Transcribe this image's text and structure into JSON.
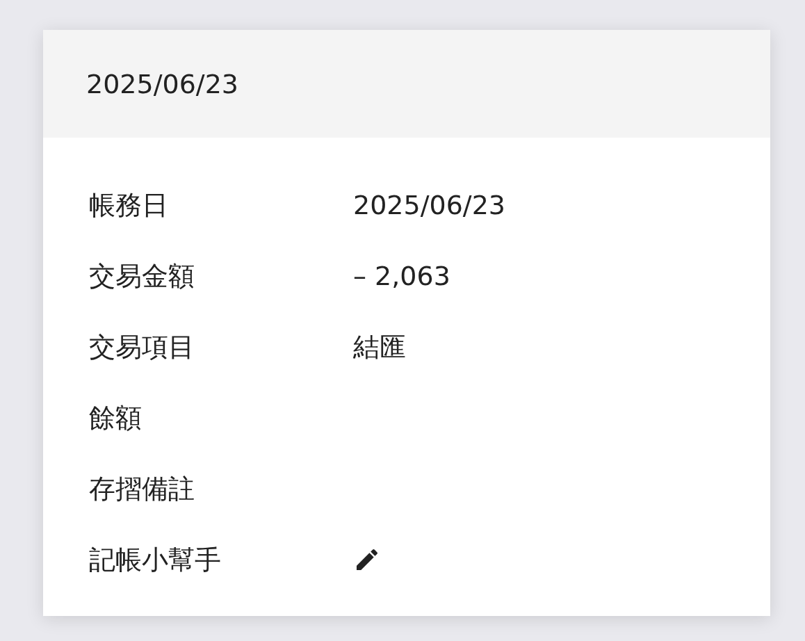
{
  "card": {
    "header_date": "2025/06/23",
    "rows": [
      {
        "kind": "text",
        "label": "帳務日",
        "value": "2025/06/23"
      },
      {
        "kind": "text",
        "label": "交易金額",
        "value": "– 2,063"
      },
      {
        "kind": "text",
        "label": "交易項目",
        "value": "結匯"
      },
      {
        "kind": "text",
        "label": "餘額"
      },
      {
        "kind": "text",
        "label": "存摺備註"
      },
      {
        "kind": "edit",
        "label": "記帳小幫手"
      }
    ]
  }
}
